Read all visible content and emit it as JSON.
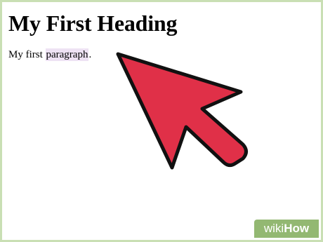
{
  "page": {
    "heading": "My First Heading",
    "paragraph_before": "My first ",
    "paragraph_highlight": "paragraph",
    "paragraph_after": "."
  },
  "cursor": {
    "icon": "arrow-pointer-icon",
    "fill_color": "#e03048",
    "stroke_color": "#111111"
  },
  "frame": {
    "border_color": "#c9dfb4"
  },
  "watermark": {
    "wiki": "wiki",
    "how": "How",
    "background_color": "#93b872"
  }
}
